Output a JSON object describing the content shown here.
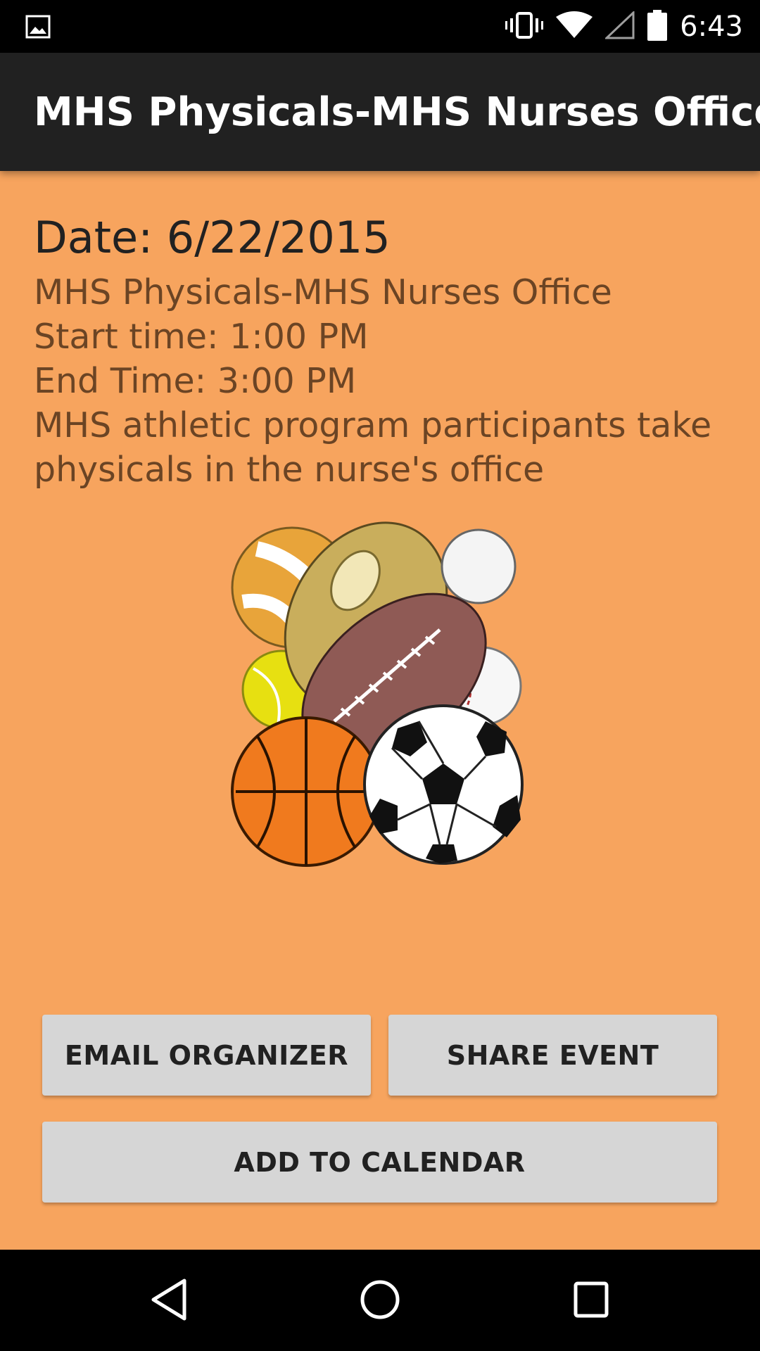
{
  "status_bar": {
    "time": "6:43",
    "icons": [
      "image-icon",
      "vibrate-icon",
      "wifi-icon",
      "signal-icon",
      "battery-icon"
    ]
  },
  "app_bar": {
    "title": "MHS Physicals-MHS Nurses Office"
  },
  "event": {
    "date": "Date: 6/22/2015",
    "title": "MHS Physicals-MHS Nurses Office",
    "start_time": "Start time: 1:00 PM",
    "end_time": "End Time: 3:00 PM",
    "description": "MHS athletic program participants take physicals in the nurse's office"
  },
  "buttons": {
    "email_organizer": "EMAIL ORGANIZER",
    "share_event": "SHARE EVENT",
    "add_to_calendar": "ADD TO CALENDAR"
  },
  "navigation": {
    "icons": [
      "back-icon",
      "home-icon",
      "recents-icon"
    ]
  },
  "colors": {
    "background": "#F7A45E",
    "app_bar": "#212121",
    "button": "#D6D6D6",
    "detail_text": "#6B4424"
  }
}
